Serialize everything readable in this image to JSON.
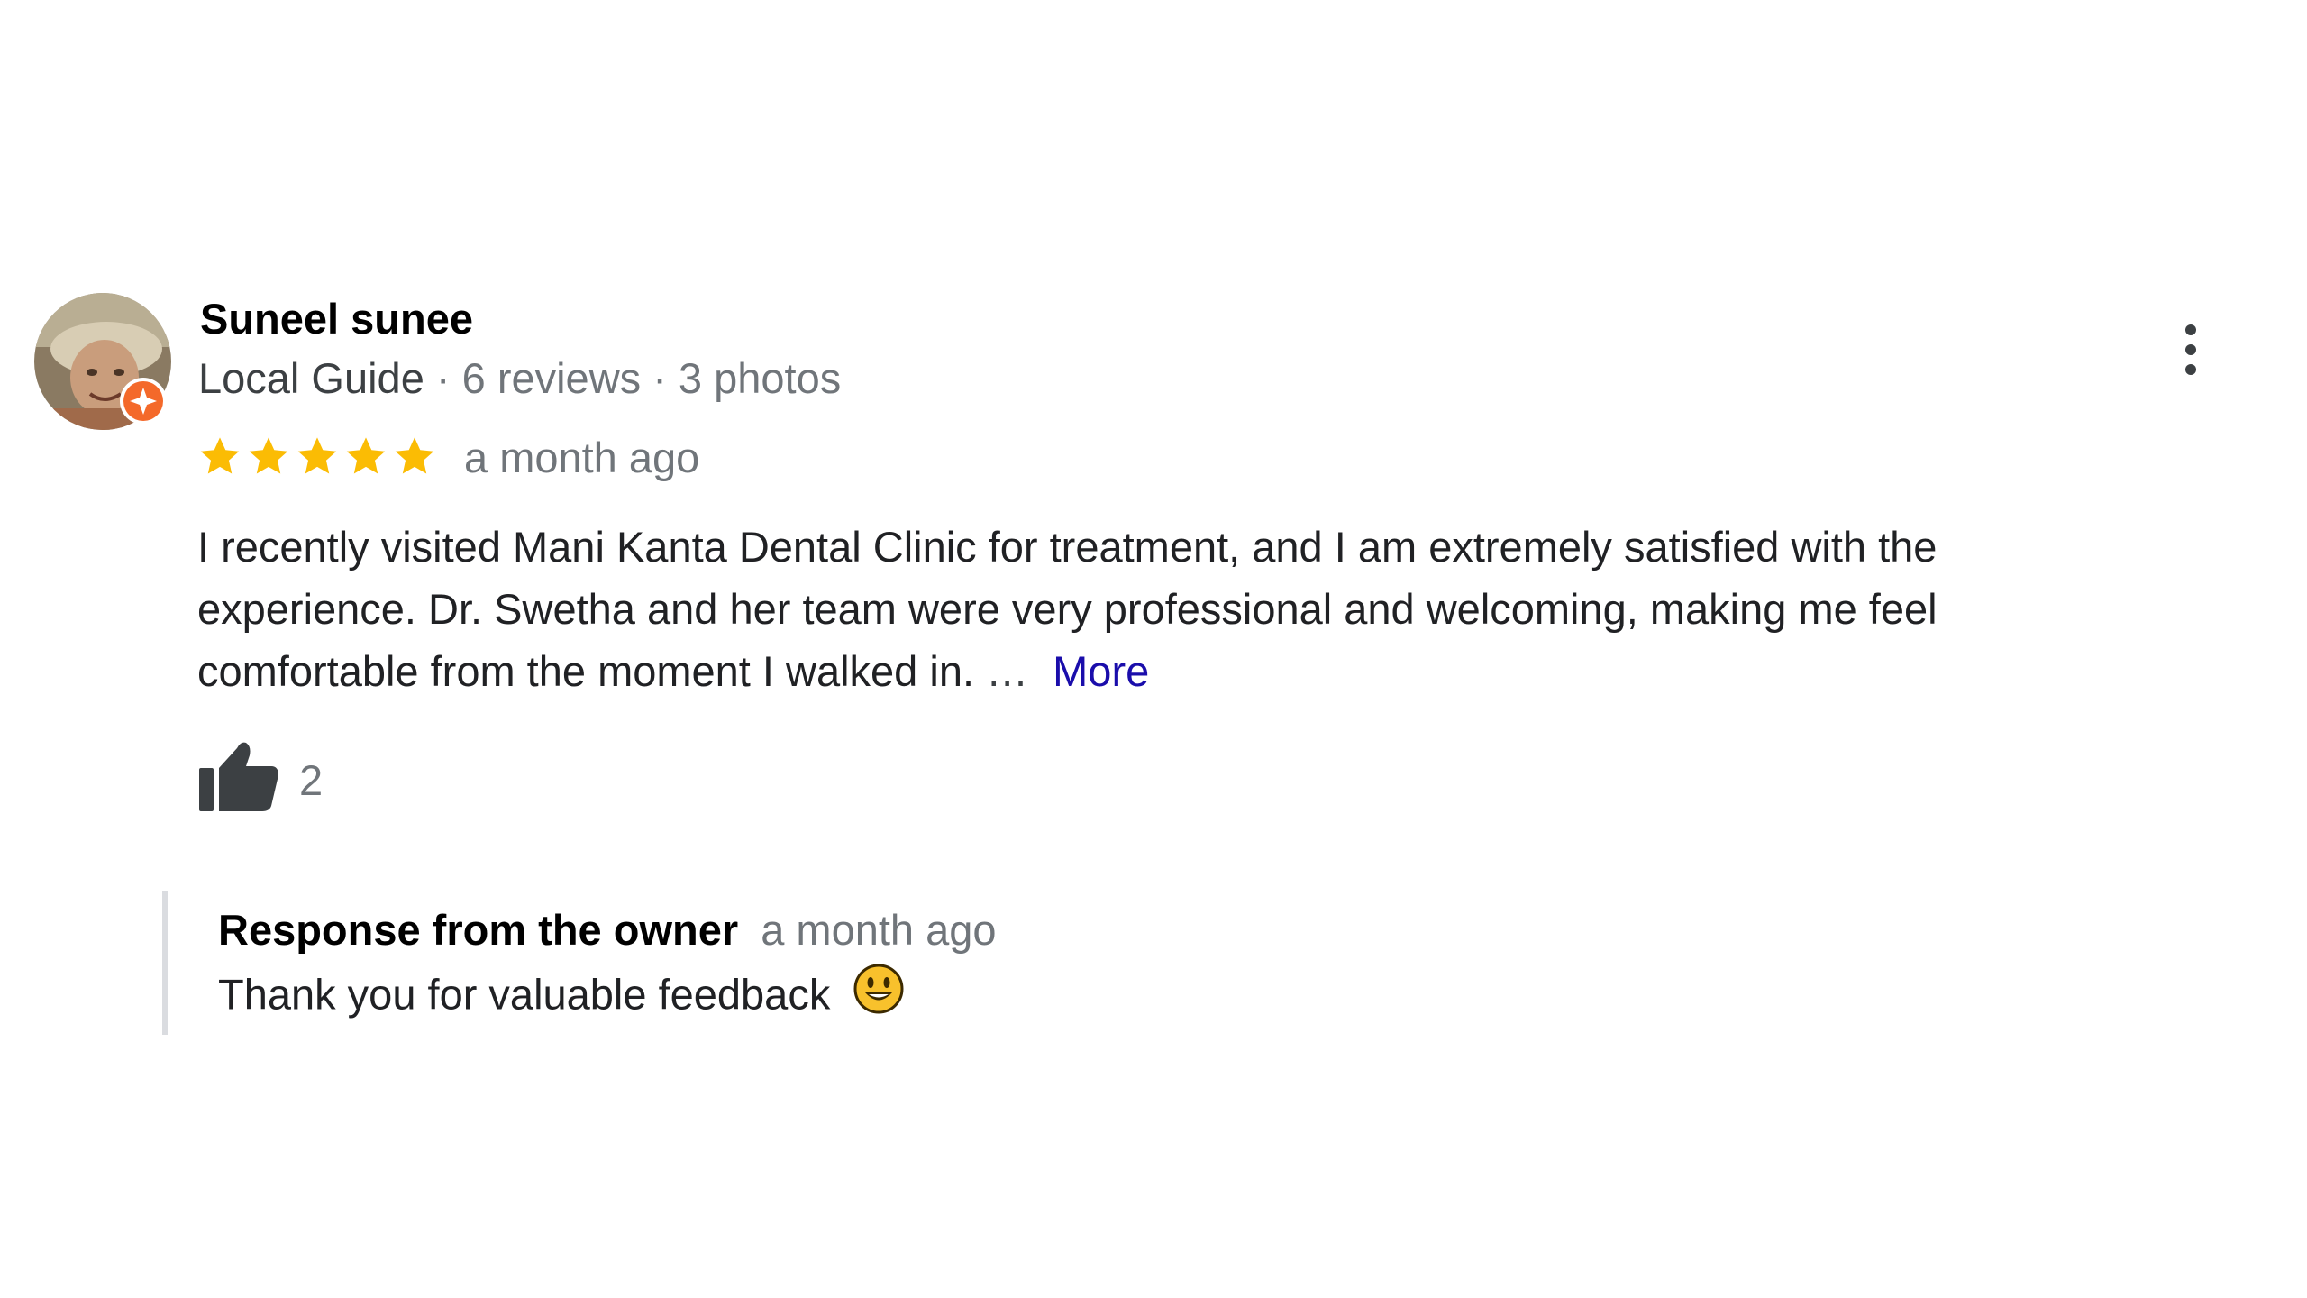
{
  "review": {
    "reviewer_name": "Suneel sunee",
    "reviewer_badge": "Local Guide",
    "separator": "·",
    "reviews_count": "6 reviews",
    "photos_count": "3 photos",
    "rating": 5,
    "max_rating": 5,
    "time": "a month ago",
    "text": "I recently visited Mani Kanta Dental Clinic for treatment, and I am extremely satisfied with the experience. Dr. Swetha and her team were very professional and welcoming, making me feel comfortable from the moment I walked in.",
    "ellipsis": "…",
    "more_label": "More",
    "likes": "2"
  },
  "owner_response": {
    "label": "Response from the owner",
    "time": "a month ago",
    "text": "Thank you for valuable feedback"
  },
  "colors": {
    "star": "#fbbc04",
    "link": "#1a0dab",
    "badge": "#f4692a",
    "muted": "#70757a"
  },
  "icons": {
    "avatar": "avatar-photo",
    "badge": "local-guide-badge-icon",
    "menu": "more-vertical-icon",
    "like": "thumbs-up-icon",
    "emoji": "smiley-emoji-icon"
  }
}
